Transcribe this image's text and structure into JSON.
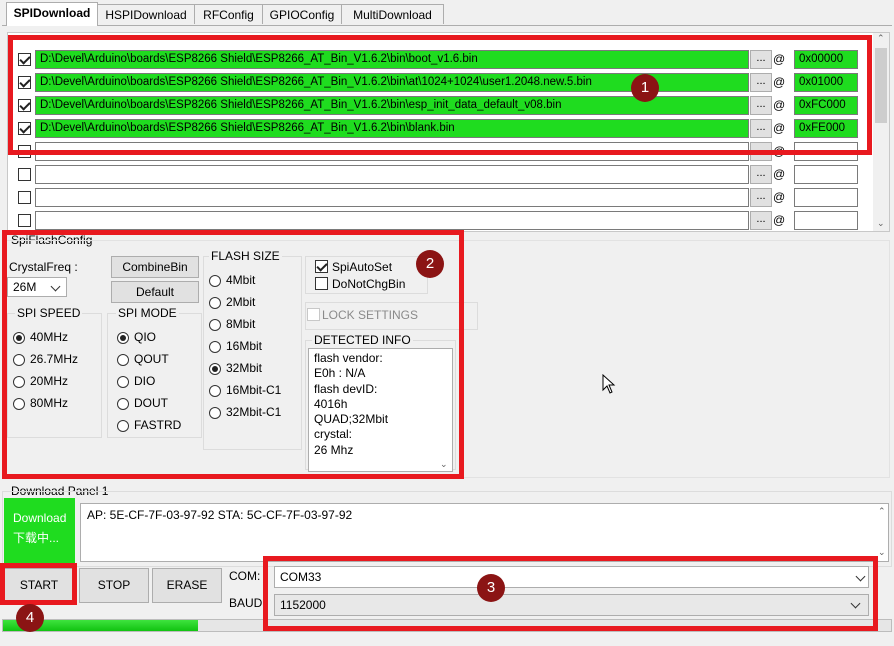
{
  "tabs": [
    "SPIDownload",
    "HSPIDownload",
    "RFConfig",
    "GPIOConfig",
    "MultiDownload"
  ],
  "files": [
    {
      "checked": true,
      "path": "D:\\Devel\\Arduino\\boards\\ESP8266 Shield\\ESP8266_AT_Bin_V1.6.2\\bin\\boot_v1.6.bin",
      "browse": "...",
      "at": "@",
      "address": "0x00000"
    },
    {
      "checked": true,
      "path": "D:\\Devel\\Arduino\\boards\\ESP8266 Shield\\ESP8266_AT_Bin_V1.6.2\\bin\\at\\1024+1024\\user1.2048.new.5.bin",
      "browse": "...",
      "at": "@",
      "address": "0x01000"
    },
    {
      "checked": true,
      "path": "D:\\Devel\\Arduino\\boards\\ESP8266 Shield\\ESP8266_AT_Bin_V1.6.2\\bin\\esp_init_data_default_v08.bin",
      "browse": "...",
      "at": "@",
      "address": "0xFC000"
    },
    {
      "checked": true,
      "path": "D:\\Devel\\Arduino\\boards\\ESP8266 Shield\\ESP8266_AT_Bin_V1.6.2\\bin\\blank.bin",
      "browse": "...",
      "at": "@",
      "address": "0xFE000"
    },
    {
      "checked": false,
      "path": "",
      "browse": "...",
      "at": "@",
      "address": ""
    },
    {
      "checked": false,
      "path": "",
      "browse": "...",
      "at": "@",
      "address": ""
    },
    {
      "checked": false,
      "path": "",
      "browse": "...",
      "at": "@",
      "address": ""
    },
    {
      "checked": false,
      "path": "",
      "browse": "...",
      "at": "@",
      "address": ""
    }
  ],
  "spiflash": {
    "title": "SpiFlashConfig",
    "crystal_label": "CrystalFreq :",
    "crystal_value": "26M",
    "combine_btn": "CombineBin",
    "default_btn": "Default",
    "speed_title": "SPI SPEED",
    "speeds": [
      "40MHz",
      "26.7MHz",
      "20MHz",
      "80MHz"
    ],
    "mode_title": "SPI MODE",
    "modes": [
      "QIO",
      "QOUT",
      "DIO",
      "DOUT",
      "FASTRD"
    ],
    "size_title": "FLASH SIZE",
    "sizes": [
      "4Mbit",
      "2Mbit",
      "8Mbit",
      "16Mbit",
      "32Mbit",
      "16Mbit-C1",
      "32Mbit-C1"
    ],
    "spiautoset": "SpiAutoSet",
    "donotchgbin": "DoNotChgBin",
    "lock": "LOCK SETTINGS",
    "detected_title": "DETECTED INFO",
    "detected_lines": [
      "flash vendor:",
      "E0h : N/A",
      "flash devID:",
      "4016h",
      "QUAD;32Mbit",
      "crystal:",
      "26 Mhz"
    ]
  },
  "download": {
    "title": "Download Panel 1",
    "status_line1": "Download",
    "status_line2": "下载中...",
    "status_color": "#1fdc1f",
    "log": "AP:  5E-CF-7F-03-97-92  STA:  5C-CF-7F-03-97-92",
    "start": "START",
    "stop": "STOP",
    "erase": "ERASE",
    "com_label": "COM:",
    "com_value": "COM33",
    "baud_label": "BAUD:",
    "baud_value": "1152000",
    "progress": 0.22
  },
  "badges": [
    "1",
    "2",
    "3",
    "4"
  ],
  "highlight_color": "#e8191f"
}
